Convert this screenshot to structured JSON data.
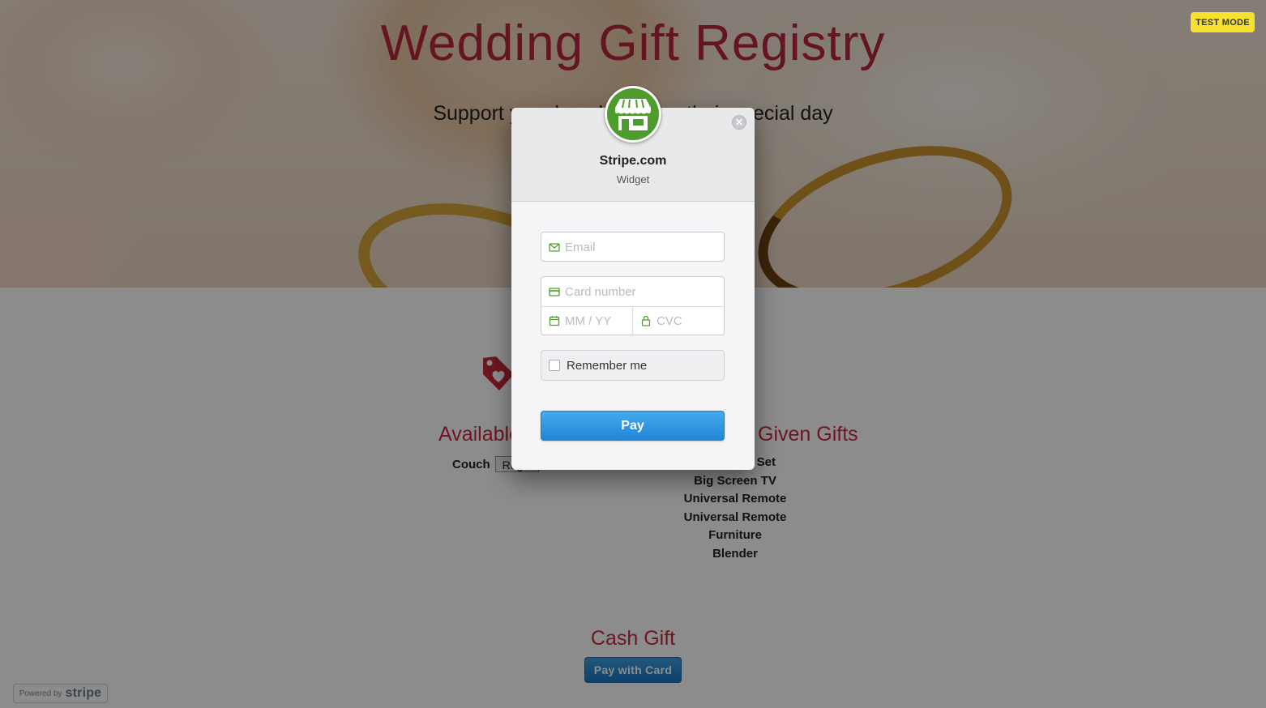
{
  "page": {
    "hero_title": "Wedding Gift Registry",
    "hero_subtitle": "Support your loved ones on their special day",
    "available_title": "Available Gifts",
    "available_items": [
      {
        "name": "Couch",
        "button": "Register"
      }
    ],
    "given_title": "Given Gifts",
    "given_items": [
      "Dishes Set",
      "Big Screen TV",
      "Universal Remote",
      "Universal Remote",
      "Furniture",
      "Blender"
    ],
    "cash_title": "Cash Gift",
    "pay_with_card": "Pay with Card",
    "powered_prefix": "Powered by",
    "powered_brand": "stripe"
  },
  "test_mode_badge": "TEST MODE",
  "checkout": {
    "merchant": "Stripe.com",
    "description": "Widget",
    "email_placeholder": "Email",
    "card_placeholder": "Card number",
    "expiry_placeholder": "MM / YY",
    "cvc_placeholder": "CVC",
    "remember_label": "Remember me",
    "remember_checked": false,
    "pay_label": "Pay",
    "logo_icon": "storefront-icon",
    "close_icon": "close-icon"
  },
  "colors": {
    "brand_red": "#c8283d",
    "pay_blue": "#2185d6",
    "logo_green": "#4e9d2c",
    "test_mode_yellow": "#f5e12e",
    "field_icon_green": "#4e9d2c"
  }
}
